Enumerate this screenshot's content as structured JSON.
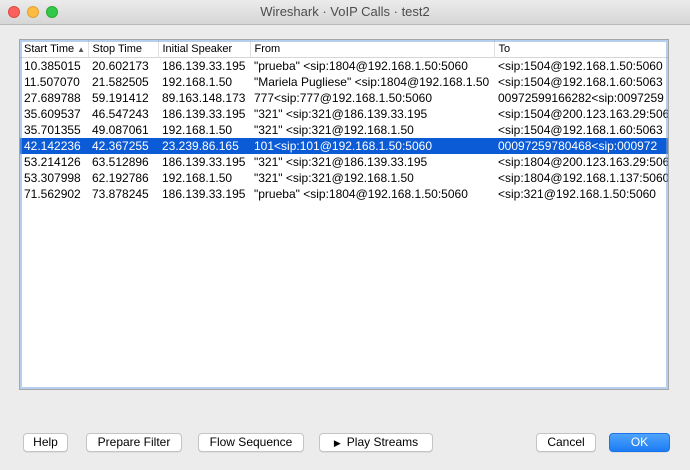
{
  "window": {
    "title": "Wireshark · VoIP Calls · test2"
  },
  "table": {
    "columns": [
      "Start Time",
      "Stop Time",
      "Initial Speaker",
      "From",
      "To"
    ],
    "sorted_column": "Start Time",
    "rows": [
      [
        "10.385015",
        "20.602173",
        "186.139.33.195",
        "\"prueba\" <sip:1804@192.168.1.50:5060",
        "<sip:1504@192.168.1.50:5060"
      ],
      [
        "11.507070",
        "21.582505",
        "192.168.1.50",
        "\"Mariela Pugliese\" <sip:1804@192.168.1.50",
        "<sip:1504@192.168.1.60:5063"
      ],
      [
        "27.689788",
        "59.191412",
        "89.163.148.173",
        "777<sip:777@192.168.1.50:5060",
        "00972599166282<sip:0097259"
      ],
      [
        "35.609537",
        "46.547243",
        "186.139.33.195",
        "\"321\" <sip:321@186.139.33.195",
        "<sip:1504@200.123.163.29:506"
      ],
      [
        "35.701355",
        "49.087061",
        "192.168.1.50",
        "\"321\" <sip:321@192.168.1.50",
        "<sip:1504@192.168.1.60:5063"
      ],
      [
        "42.142236",
        "42.367255",
        "23.239.86.165",
        "101<sip:101@192.168.1.50:5060",
        "00097259780468<sip:000972"
      ],
      [
        "53.214126",
        "63.512896",
        "186.139.33.195",
        "\"321\" <sip:321@186.139.33.195",
        "<sip:1804@200.123.163.29:506"
      ],
      [
        "53.307998",
        "62.192786",
        "192.168.1.50",
        "\"321\" <sip:321@192.168.1.50",
        "<sip:1804@192.168.1.137:5060"
      ],
      [
        "71.562902",
        "73.878245",
        "186.139.33.195",
        "\"prueba\" <sip:1804@192.168.1.50:5060",
        "<sip:321@192.168.1.50:5060"
      ]
    ],
    "selected_row_index": 5
  },
  "buttons": {
    "help": "Help",
    "prepare_filter": "Prepare Filter",
    "flow_sequence": "Flow Sequence",
    "play_streams": "Play Streams",
    "cancel": "Cancel",
    "ok": "OK"
  },
  "icons": {
    "play": "play-icon",
    "sort": "sort-ascending-icon"
  },
  "colors": {
    "selection": "#0b5bd6",
    "primary_button": "#1c7cf4"
  }
}
